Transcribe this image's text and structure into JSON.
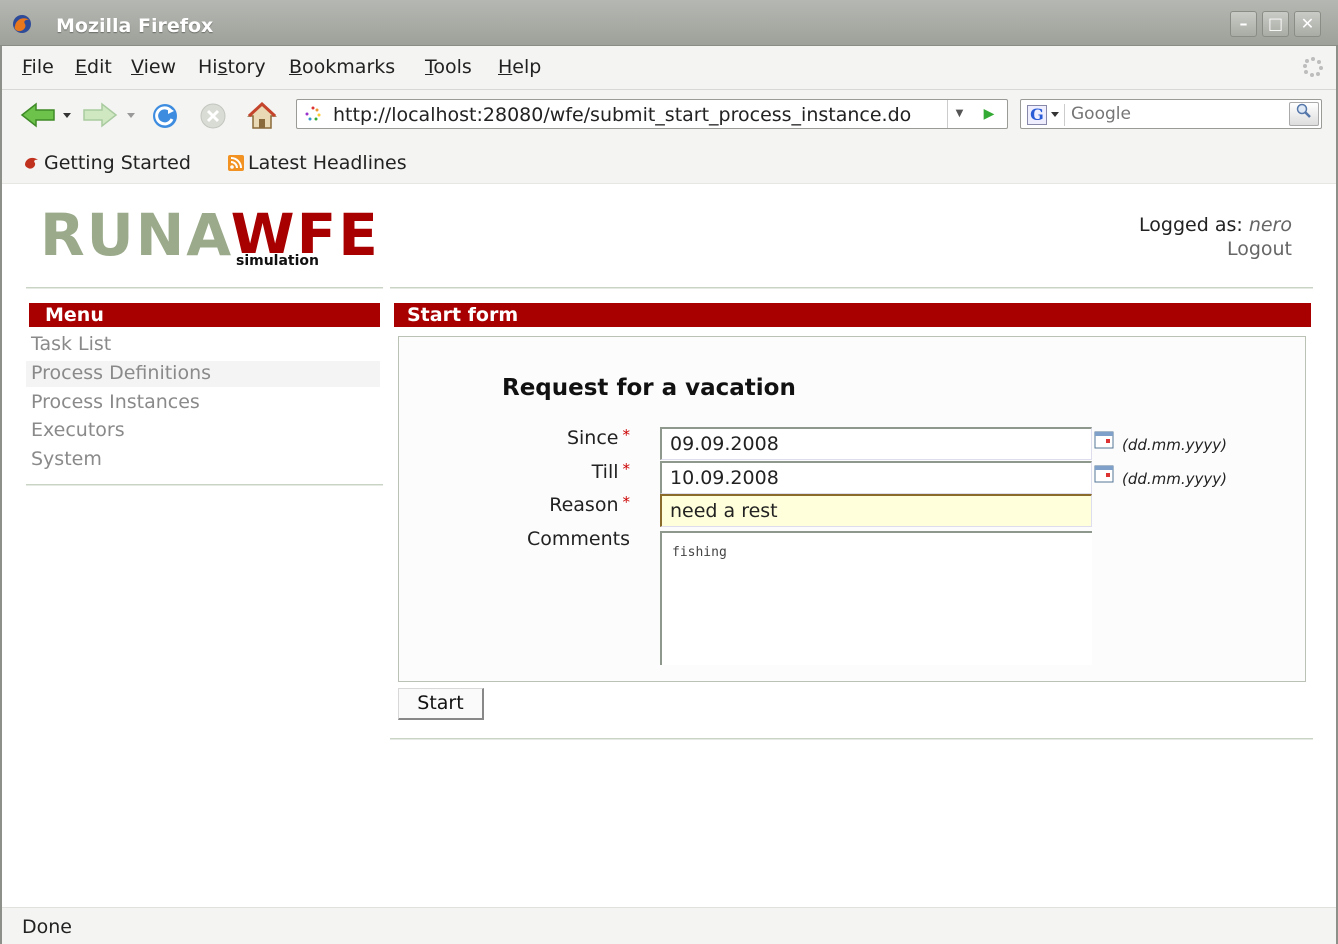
{
  "window": {
    "title": "Mozilla Firefox",
    "minimize_glyph": "–",
    "maximize_glyph": "□",
    "close_glyph": "✕"
  },
  "menubar": {
    "items": [
      {
        "label": "File",
        "key": "F",
        "rest": "ile"
      },
      {
        "label": "Edit",
        "key": "E",
        "rest": "dit"
      },
      {
        "label": "View",
        "key": "V",
        "rest": "iew"
      },
      {
        "label": "History",
        "pre": "Hi",
        "key": "s",
        "rest": "tory"
      },
      {
        "label": "Bookmarks",
        "key": "B",
        "rest": "ookmarks"
      },
      {
        "label": "Tools",
        "key": "T",
        "rest": "ools"
      },
      {
        "label": "Help",
        "key": "H",
        "rest": "elp"
      }
    ]
  },
  "navbar": {
    "url": "http://localhost:28080/wfe/submit_start_process_instance.do",
    "search_placeholder": "Google",
    "search_engine_letter": "G"
  },
  "bookmarks": {
    "items": [
      "Getting Started",
      "Latest Headlines"
    ]
  },
  "page": {
    "logo_left": "RUNA",
    "logo_right": "WFE",
    "logo_sub": "simulation",
    "logged_as_label": "Logged as:",
    "user": "nero",
    "logout": "Logout",
    "menu_title": "Menu",
    "menu_items": [
      "Task List",
      "Process Definitions",
      "Process Instances",
      "Executors",
      "System"
    ],
    "panel_title": "Start form",
    "form": {
      "title": "Request for a vacation",
      "since_label": "Since",
      "since_value": "09.09.2008",
      "till_label": "Till",
      "till_value": "10.09.2008",
      "reason_label": "Reason",
      "reason_value": "need a rest",
      "comments_label": "Comments",
      "comments_value": "fishing",
      "required_mark": "*",
      "date_hint": "(dd.mm.yyyy)",
      "submit_label": "Start"
    }
  },
  "status": {
    "text": "Done"
  },
  "colors": {
    "brand_red": "#a80000",
    "logo_grey_green": "#9aaa8a",
    "link_grey": "#8a8a8a",
    "focus_field": "#ffffdc"
  }
}
